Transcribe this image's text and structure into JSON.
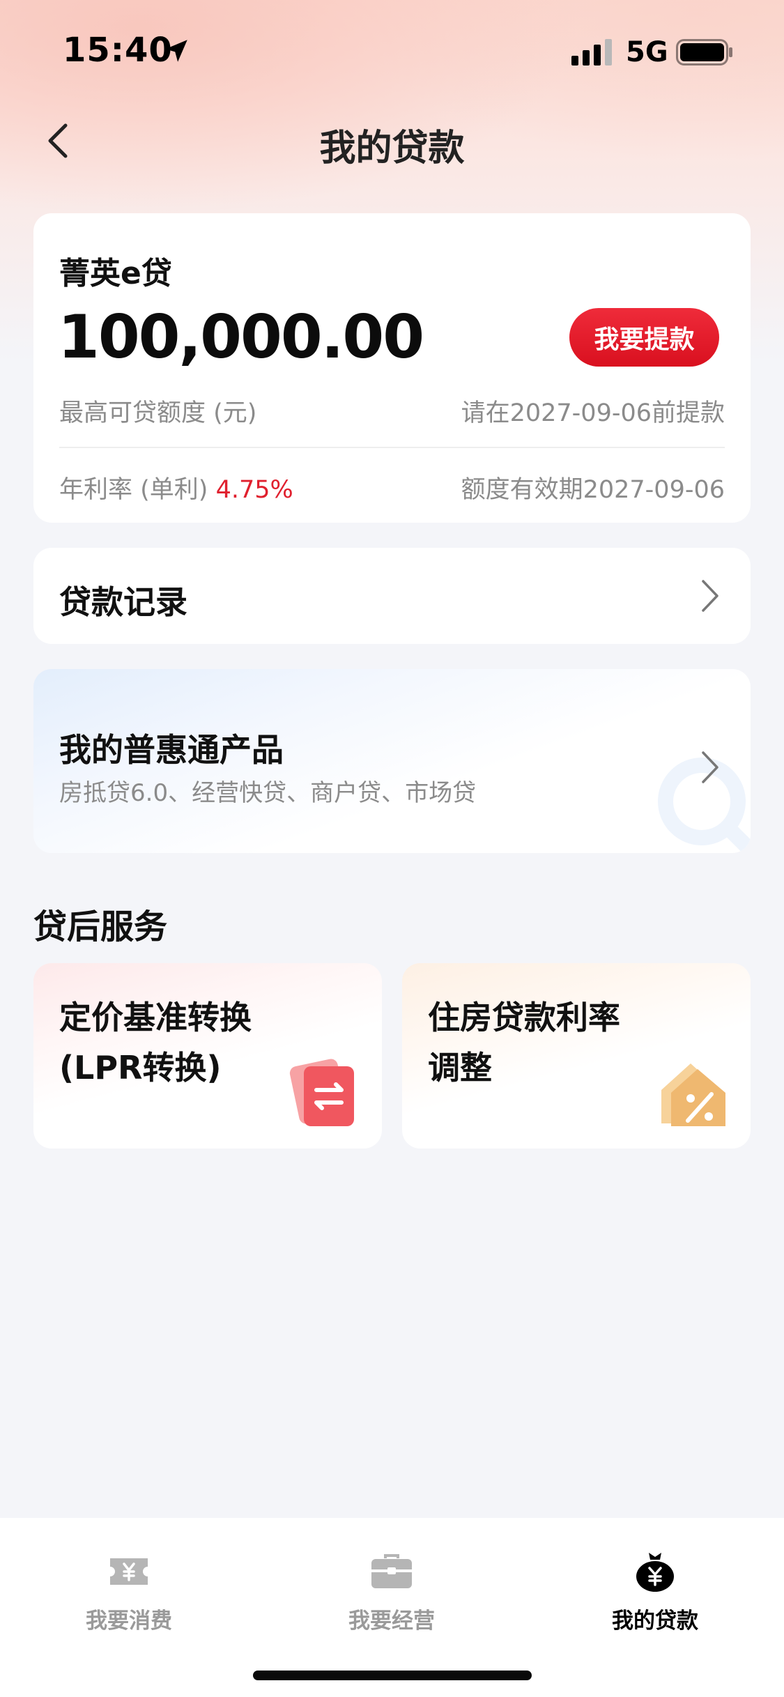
{
  "status_bar": {
    "time": "15:40",
    "network": "5G"
  },
  "nav": {
    "title": "我的贷款"
  },
  "loan_card": {
    "product_name": "菁英e贷",
    "amount": "100,000.00",
    "withdraw_button": "我要提款",
    "quota_label": "最高可贷额度 (元)",
    "deadline_text": "请在2027-09-06前提款",
    "rate_label": "年利率 (单利) ",
    "rate_value": "4.75%",
    "validity_text": "额度有效期2027-09-06"
  },
  "loan_record": {
    "label": "贷款记录"
  },
  "puhui": {
    "title": "我的普惠通产品",
    "subtitle": "房抵贷6.0、经营快贷、商户贷、市场贷"
  },
  "after_loan": {
    "section_title": "贷后服务",
    "items": [
      {
        "line1": "定价基准转换",
        "line2": "(LPR转换)"
      },
      {
        "line1": "住房贷款利率",
        "line2": "调整"
      }
    ]
  },
  "tabbar": {
    "tabs": [
      {
        "label": "我要消费",
        "icon": "ticket-yen-icon",
        "active": false
      },
      {
        "label": "我要经营",
        "icon": "briefcase-icon",
        "active": false
      },
      {
        "label": "我的贷款",
        "icon": "money-bag-icon",
        "active": true
      }
    ]
  },
  "colors": {
    "accent_red": "#e0202e",
    "background": "#f4f5f9"
  }
}
